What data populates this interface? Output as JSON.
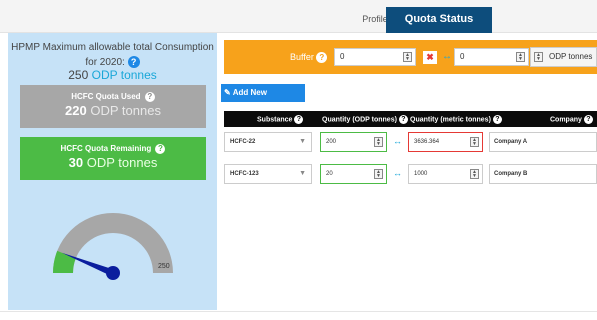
{
  "tabs": {
    "profile": "Profile",
    "quota_status": "Quota Status"
  },
  "summary": {
    "title": "HPMP Maximum allowable total Consumption for 2020:",
    "total_value": "250",
    "total_unit": "ODP tonnes",
    "used_label": "HCFC Quota Used",
    "used_value": "220",
    "used_unit": "ODP tonnes",
    "remaining_label": "HCFC Quota Remaining",
    "remaining_value": "30",
    "remaining_unit": "ODP tonnes"
  },
  "gauge": {
    "max_label": "250",
    "value": 30,
    "max": 250,
    "colors": {
      "track": "#a7a7a7",
      "fill": "#4cbb45",
      "needle": "#0b1e9e"
    }
  },
  "buffer": {
    "label": "Buffer",
    "value1": "0",
    "value2": "0",
    "unit": "ODP tonnes"
  },
  "actions": {
    "add_allocation": "Add New Allocation"
  },
  "table": {
    "headers": {
      "substance": "Substance",
      "quantity_odp": "Quantity (ODP tonnes)",
      "quantity_metric": "Quantity (metric tonnes)",
      "company": "Company"
    },
    "rows": [
      {
        "substance": "HCFC-22",
        "quantity_odp": "200",
        "quantity_metric": "3636.364",
        "company": "Company A"
      },
      {
        "substance": "HCFC-123",
        "quantity_odp": "20",
        "quantity_metric": "1000",
        "company": "Company B"
      }
    ]
  },
  "colors": {
    "header_tab": "#0d4d7c",
    "panel": "#c6e2f7",
    "buffer": "#f7a21b",
    "accent": "#1e88e5",
    "used": "#a7a7a7",
    "remaining": "#4cbb45",
    "error": "#e53935"
  },
  "icons": {
    "help": "question-circle-icon",
    "swap": "swap-arrows-icon",
    "add": "edit-pen-icon",
    "spinner": "spinner-arrows-icon",
    "clear": "clear-x-icon"
  }
}
